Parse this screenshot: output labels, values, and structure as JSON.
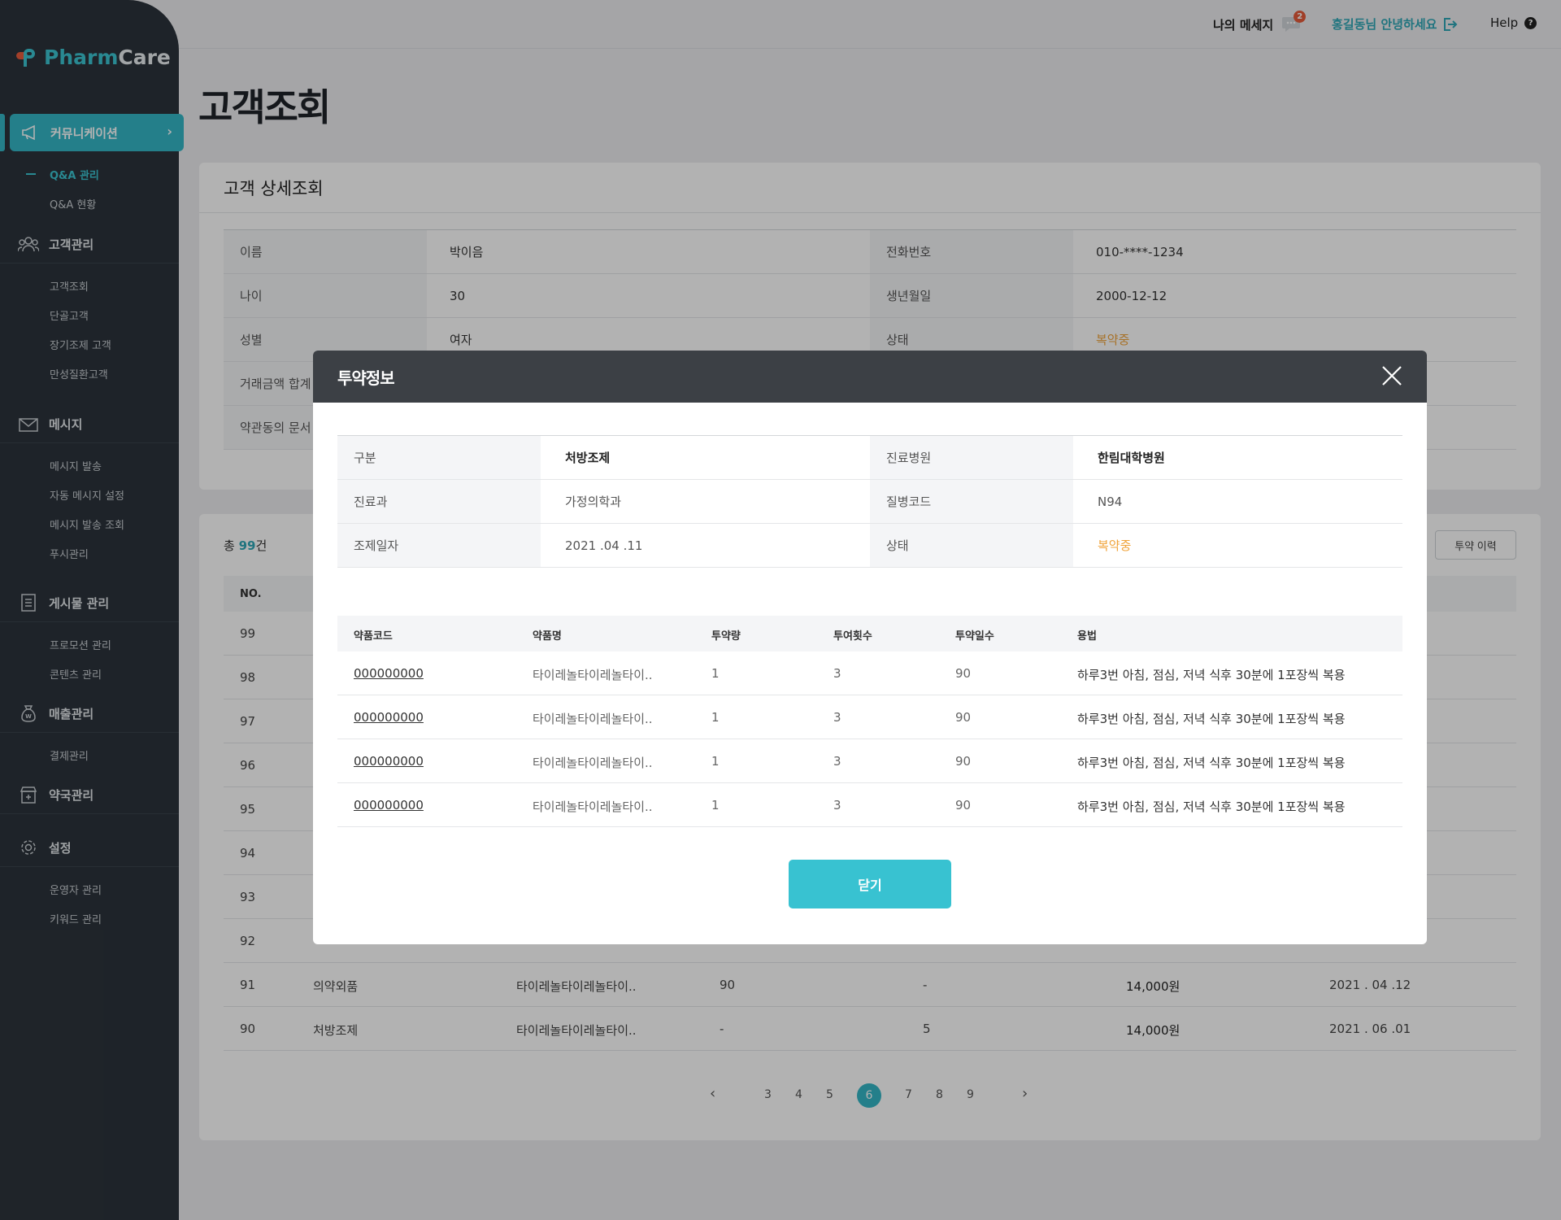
{
  "brand": {
    "part1": "Pharm",
    "part2": "Care"
  },
  "header": {
    "messages": "나의 메세지",
    "badge": "2",
    "user": "홍길동님 안녕하세요",
    "help": "Help",
    "help_icon": "?"
  },
  "sidebar": {
    "active": "커뮤니케이션",
    "comm_subs": [
      "Q&A 관리",
      "Q&A 현황"
    ],
    "sections": [
      {
        "label": "고객관리",
        "icon": "users-icon",
        "subs": [
          "고객조회",
          "단골고객",
          "장기조제 고객",
          "만성질환고객"
        ]
      },
      {
        "label": "메시지",
        "icon": "mail-icon",
        "subs": [
          "메시지 발송",
          "자동 메시지 설정",
          "메시지 발송 조회",
          "푸시관리"
        ]
      },
      {
        "label": "게시물 관리",
        "icon": "board-icon",
        "subs": [
          "프로모션 관리",
          "콘텐츠 관리"
        ]
      },
      {
        "label": "매출관리",
        "icon": "money-bag-icon",
        "subs": [
          "결제관리"
        ]
      },
      {
        "label": "약국관리",
        "icon": "pharmacy-icon",
        "subs": []
      },
      {
        "label": "설정",
        "icon": "gear-icon",
        "subs": [
          "운영자 관리",
          "키워드 관리"
        ]
      }
    ]
  },
  "page": {
    "title": "고객조회"
  },
  "detail": {
    "title": "고객 상세조회",
    "rows": [
      {
        "l1": "이름",
        "v1": "박이음",
        "l2": "전화번호",
        "v2": "010-****-1234"
      },
      {
        "l1": "나이",
        "v1": "30",
        "l2": "생년월일",
        "v2": "2000-12-12"
      },
      {
        "l1": "성별",
        "v1": "여자",
        "l2": "상태",
        "v2": "복약중"
      },
      {
        "l1": "거래금액 합계",
        "v1": "",
        "l2": "",
        "v2": ""
      },
      {
        "l1": "약관동의 문서",
        "v1": "",
        "l2": "",
        "v2": ""
      }
    ]
  },
  "list": {
    "total_prefix": "총 ",
    "total_count": "99",
    "total_suffix": "건",
    "history_button": "투약 이력",
    "head_no": "NO.",
    "rows": [
      {
        "no": "99"
      },
      {
        "no": "98"
      },
      {
        "no": "97"
      },
      {
        "no": "96"
      },
      {
        "no": "95"
      },
      {
        "no": "94"
      },
      {
        "no": "93"
      },
      {
        "no": "92"
      },
      {
        "no": "91",
        "type": "의약외품",
        "name": "타이레놀타이레놀타이..",
        "qty": "90",
        "cnt": "-",
        "price": "14,000원",
        "date": "2021 . 04 .12"
      },
      {
        "no": "90",
        "type": "처방조제",
        "name": "타이레놀타이레놀타이..",
        "qty": "-",
        "cnt": "5",
        "price": "14,000원",
        "date": "2021 . 06 .01"
      }
    ],
    "pages": [
      "3",
      "4",
      "5",
      "6",
      "7",
      "8",
      "9"
    ],
    "prev": "‹",
    "next": "›"
  },
  "modal": {
    "title": "투약정보",
    "info": [
      {
        "l1": "구분",
        "v1": "처방조제",
        "l2": "진료병원",
        "v2": "한림대학병원"
      },
      {
        "l1": "진료과",
        "v1": "가정의학과",
        "l2": "질병코드",
        "v2": "N94"
      },
      {
        "l1": "조제일자",
        "v1": "2021 .04 .11",
        "l2": "상태",
        "v2": "복약중"
      }
    ],
    "columns": [
      "약품코드",
      "약품명",
      "투약량",
      "투여횟수",
      "투약일수",
      "용법"
    ],
    "rows": [
      {
        "code": "000000000",
        "name": "타이레놀타이레놀타이..",
        "dose": "1",
        "times": "3",
        "days": "90",
        "usage": "하루3번 아침, 점심, 저녁 식후 30분에 1포장씩 복용"
      },
      {
        "code": "000000000",
        "name": "타이레놀타이레놀타이..",
        "dose": "1",
        "times": "3",
        "days": "90",
        "usage": "하루3번 아침, 점심, 저녁 식후 30분에 1포장씩 복용"
      },
      {
        "code": "000000000",
        "name": "타이레놀타이레놀타이..",
        "dose": "1",
        "times": "3",
        "days": "90",
        "usage": "하루3번 아침, 점심, 저녁 식후 30분에 1포장씩 복용"
      },
      {
        "code": "000000000",
        "name": "타이레놀타이레놀타이..",
        "dose": "1",
        "times": "3",
        "days": "90",
        "usage": "하루3번 아침, 점심, 저녁 식후 30분에 1포장씩 복용"
      }
    ],
    "close_button": "닫기"
  },
  "colors": {
    "accent": "#38c2d1",
    "status": "#f0a43c",
    "sidebar": "#2c333b",
    "modal_header": "#3c4045"
  }
}
